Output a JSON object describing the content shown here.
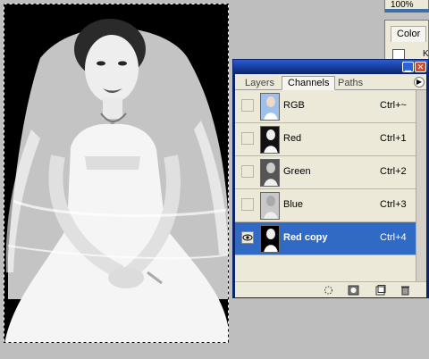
{
  "navigator": {
    "zoom": "100%"
  },
  "color_panel": {
    "tab_label": "Color",
    "channel_letter": "K"
  },
  "palette": {
    "tabs": [
      {
        "label": "Layers"
      },
      {
        "label": "Channels"
      },
      {
        "label": "Paths"
      }
    ],
    "active_tab": "Channels",
    "channels": [
      {
        "name": "RGB",
        "shortcut": "Ctrl+~",
        "visible": false,
        "selected": false
      },
      {
        "name": "Red",
        "shortcut": "Ctrl+1",
        "visible": false,
        "selected": false
      },
      {
        "name": "Green",
        "shortcut": "Ctrl+2",
        "visible": false,
        "selected": false
      },
      {
        "name": "Blue",
        "shortcut": "Ctrl+3",
        "visible": false,
        "selected": false
      },
      {
        "name": "Red copy",
        "shortcut": "Ctrl+4",
        "visible": true,
        "selected": true
      }
    ],
    "footer_icons": [
      "load-selection-icon",
      "save-selection-icon",
      "new-channel-icon",
      "trash-icon"
    ]
  },
  "colors": {
    "selection": "#316ac5",
    "titlebar": "#0a246a",
    "panel_bg": "#ece9d8"
  }
}
